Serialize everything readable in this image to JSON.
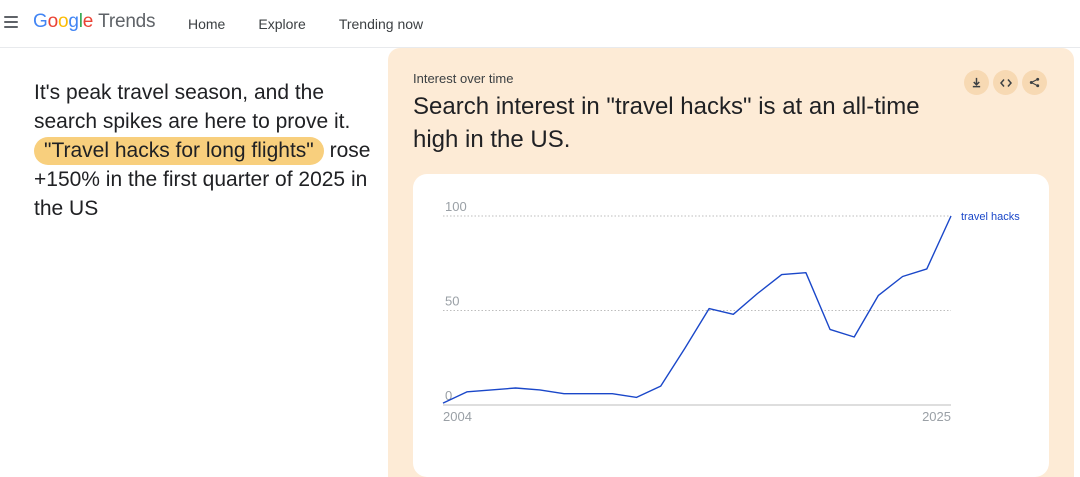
{
  "header": {
    "logo_google": "Google",
    "logo_trends": "Trends",
    "nav": [
      {
        "label": "Home"
      },
      {
        "label": "Explore"
      },
      {
        "label": "Trending now"
      }
    ]
  },
  "intro": {
    "text_before": "It's peak travel season, and the search spikes are here to prove it.",
    "highlight": "\"Travel hacks for long flights\"",
    "text_after": "rose +150% in the first quarter of 2025 in the US"
  },
  "panel": {
    "label": "Interest over time",
    "title": "Search interest in \"travel hacks\" is at an all-time high in the US.",
    "actions": [
      {
        "icon": "download-icon",
        "glyph": "⤓"
      },
      {
        "icon": "embed-code-icon",
        "glyph": "‹›"
      },
      {
        "icon": "share-icon",
        "glyph": "⋖"
      }
    ]
  },
  "chart_data": {
    "type": "line",
    "x_start_label": "2004",
    "x_end_label": "2025",
    "yticks": [
      "100",
      "50",
      "0"
    ],
    "ylim": [
      0,
      100
    ],
    "grid": true,
    "legend_placement": "line-end",
    "series": [
      {
        "name": "travel hacks",
        "color": "#1a47c9",
        "values": [
          1,
          7,
          8,
          9,
          8,
          6,
          6,
          6,
          4,
          10,
          30,
          51,
          48,
          59,
          69,
          70,
          40,
          36,
          58,
          68,
          72,
          100
        ]
      }
    ]
  }
}
